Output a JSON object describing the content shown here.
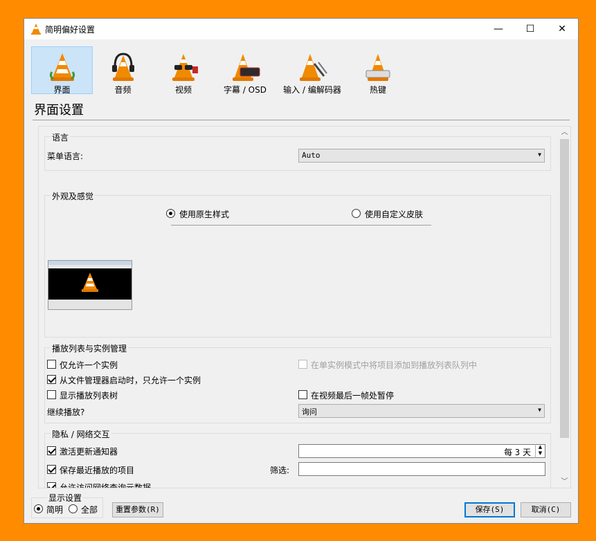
{
  "window": {
    "title": "简明偏好设置",
    "minimize": "—",
    "maximize": "☐",
    "close": "✕"
  },
  "tabs": [
    {
      "label": "界面"
    },
    {
      "label": "音频"
    },
    {
      "label": "视频"
    },
    {
      "label": "字幕 / OSD"
    },
    {
      "label": "输入 / 编解码器"
    },
    {
      "label": "热键"
    }
  ],
  "section_title": "界面设置",
  "language": {
    "group_title": "语言",
    "menu_language_label": "菜单语言:",
    "menu_language_value": "Auto"
  },
  "look_feel": {
    "group_title": "外观及感觉",
    "native_style": "使用原生样式",
    "custom_skin": "使用自定义皮肤"
  },
  "playlist": {
    "group_title": "播放列表与实例管理",
    "one_instance": "仅允许一个实例",
    "enqueue": "在单实例模式中将项目添加到播放列表队列中",
    "file_manager": "从文件管理器启动时，只允许一个实例",
    "show_tree": "显示播放列表树",
    "pause_last": "在视频最后一帧处暂停",
    "continue_label": "继续播放?",
    "continue_value": "询问"
  },
  "privacy": {
    "group_title": "隐私 / 网络交互",
    "update_notify": "激活更新通知器",
    "update_every": "每",
    "update_days": "3",
    "update_unit": "天",
    "recent_items": "保存最近播放的项目",
    "filter_label": "筛选:",
    "metadata": "允许访问网络查询元数据"
  },
  "footer": {
    "show_settings": "显示设置",
    "simple": "简明",
    "all": "全部",
    "reset": "重置参数(R)",
    "save": "保存(S)",
    "cancel": "取消(C)"
  }
}
